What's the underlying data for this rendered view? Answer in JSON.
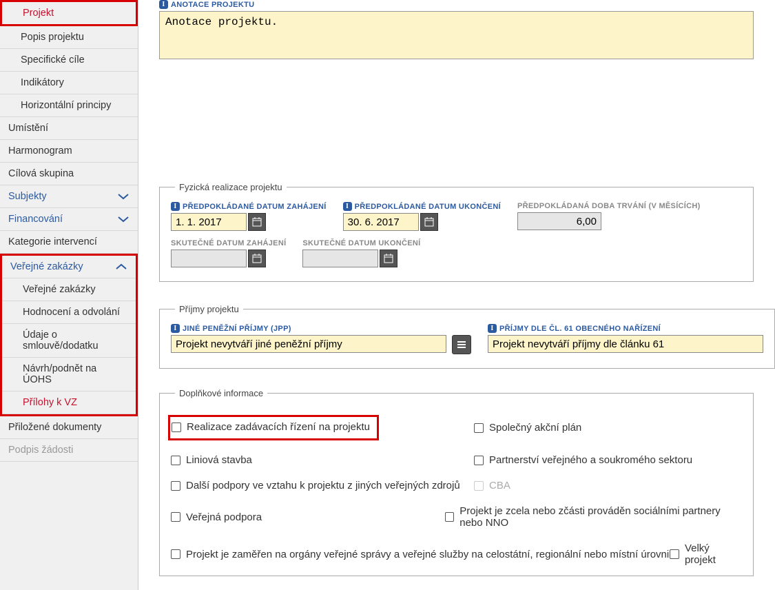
{
  "sidebar": {
    "projekt": "Projekt",
    "popis": "Popis projektu",
    "cile": "Specifické cíle",
    "indikatory": "Indikátory",
    "horizont": "Horizontální principy",
    "umisteni": "Umístění",
    "harmonogram": "Harmonogram",
    "cilova": "Cílová skupina",
    "subjekty": "Subjekty",
    "financovani": "Financování",
    "kategorie": "Kategorie intervencí",
    "vz": "Veřejné zakázky",
    "vz_sub": "Veřejné zakázky",
    "hodnoceni": "Hodnocení a odvolání",
    "udaje": "Údaje o smlouvě/dodatku",
    "navrh": "Návrh/podnět na ÚOHS",
    "prilohy_vz": "Přílohy k VZ",
    "prilozene": "Přiložené dokumenty",
    "podpis": "Podpis žádosti"
  },
  "anotace": {
    "label": "ANOTACE PROJEKTU",
    "value": "Anotace projektu."
  },
  "fyzicka": {
    "legend": "Fyzická realizace projektu",
    "zahajeni_label": "PŘEDPOKLÁDANÉ DATUM ZAHÁJENÍ",
    "zahajeni_value": "1. 1. 2017",
    "ukonceni_label": "PŘEDPOKLÁDANÉ DATUM UKONČENÍ",
    "ukonceni_value": "30. 6. 2017",
    "doba_label": "PŘEDPOKLÁDANÁ DOBA TRVÁNÍ (V MĚSÍCÍCH)",
    "doba_value": "6,00",
    "skut_zah_label": "SKUTEČNÉ DATUM ZAHÁJENÍ",
    "skut_uk_label": "SKUTEČNÉ DATUM UKONČENÍ"
  },
  "prijmy": {
    "legend": "Příjmy projektu",
    "jpp_label": "JINÉ PENĚŽNÍ PŘÍJMY (JPP)",
    "jpp_value": "Projekt nevytváří jiné peněžní příjmy",
    "cl61_label": "PŘÍJMY DLE ČL. 61 OBECNÉHO NAŘÍZENÍ",
    "cl61_value": "Projekt nevytváří příjmy dle článku 61"
  },
  "doplnkove": {
    "legend": "Doplňkové informace",
    "realizace": "Realizace zadávacích řízení na projektu",
    "spolecny": "Společný akční plán",
    "liniova": "Liniová stavba",
    "partnerstvi": "Partnerství veřejného a soukromého sektoru",
    "dalsi": "Další podpory ve vztahu k projektu z jiných veřejných zdrojů",
    "cba": "CBA",
    "verejna": "Veřejná podpora",
    "socialni": "Projekt je zcela nebo zčásti prováděn sociálními partnery nebo NNO",
    "organy": "Projekt je zaměřen na orgány veřejné správy a veřejné služby na celostátní, regionální nebo místní úrovni",
    "velky": "Velký projekt"
  }
}
